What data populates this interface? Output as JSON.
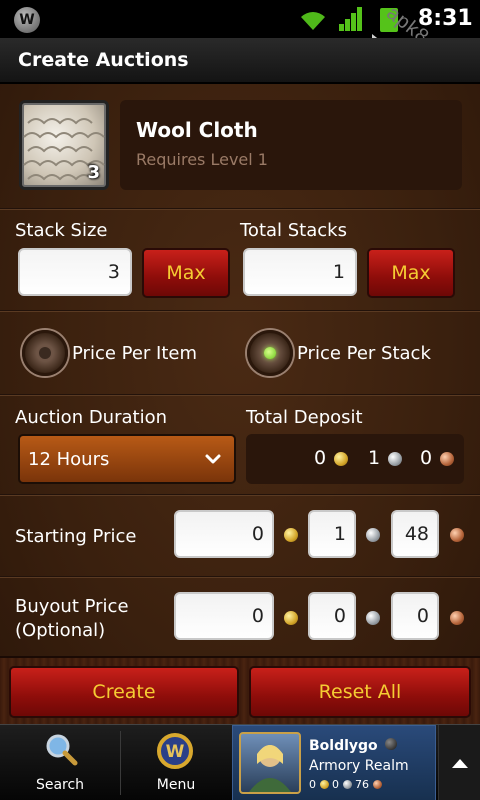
{
  "status_bar": {
    "time": "8:31",
    "watermark": "apk8.com",
    "app_icon": "W",
    "icons": [
      "app-notification-icon",
      "wifi-icon",
      "signal-icon",
      "battery-icon"
    ]
  },
  "header": {
    "title": "Create Auctions"
  },
  "item": {
    "name": "Wool Cloth",
    "requirement": "Requires Level 1",
    "quantity": "3",
    "icon": "wool-cloth-icon"
  },
  "stack": {
    "size_label": "Stack Size",
    "size_value": "3",
    "total_label": "Total Stacks",
    "total_value": "1",
    "max_label": "Max"
  },
  "pricing_mode": {
    "per_item_label": "Price Per Item",
    "per_stack_label": "Price Per Stack",
    "selected": "per_stack"
  },
  "duration": {
    "label": "Auction Duration",
    "value": "12 Hours"
  },
  "deposit": {
    "label": "Total Deposit",
    "gold": "0",
    "silver": "1",
    "copper": "0"
  },
  "starting_price": {
    "label": "Starting Price",
    "gold": "0",
    "silver": "1",
    "copper": "48"
  },
  "buyout_price": {
    "label_line1": "Buyout Price",
    "label_line2": "(Optional)",
    "gold": "0",
    "silver": "0",
    "copper": "0"
  },
  "actions": {
    "create_label": "Create",
    "reset_label": "Reset All"
  },
  "nav": {
    "search_label": "Search",
    "menu_label": "Menu",
    "character": {
      "name": "Boldlygo",
      "realm": "Armory Realm",
      "gold": "0",
      "silver": "0",
      "copper": "76"
    }
  },
  "colors": {
    "accent_text": "#f5cc33",
    "button_red": "#a8140f",
    "panel_brown": "#2a160b",
    "background_brown": "#3a200e"
  }
}
